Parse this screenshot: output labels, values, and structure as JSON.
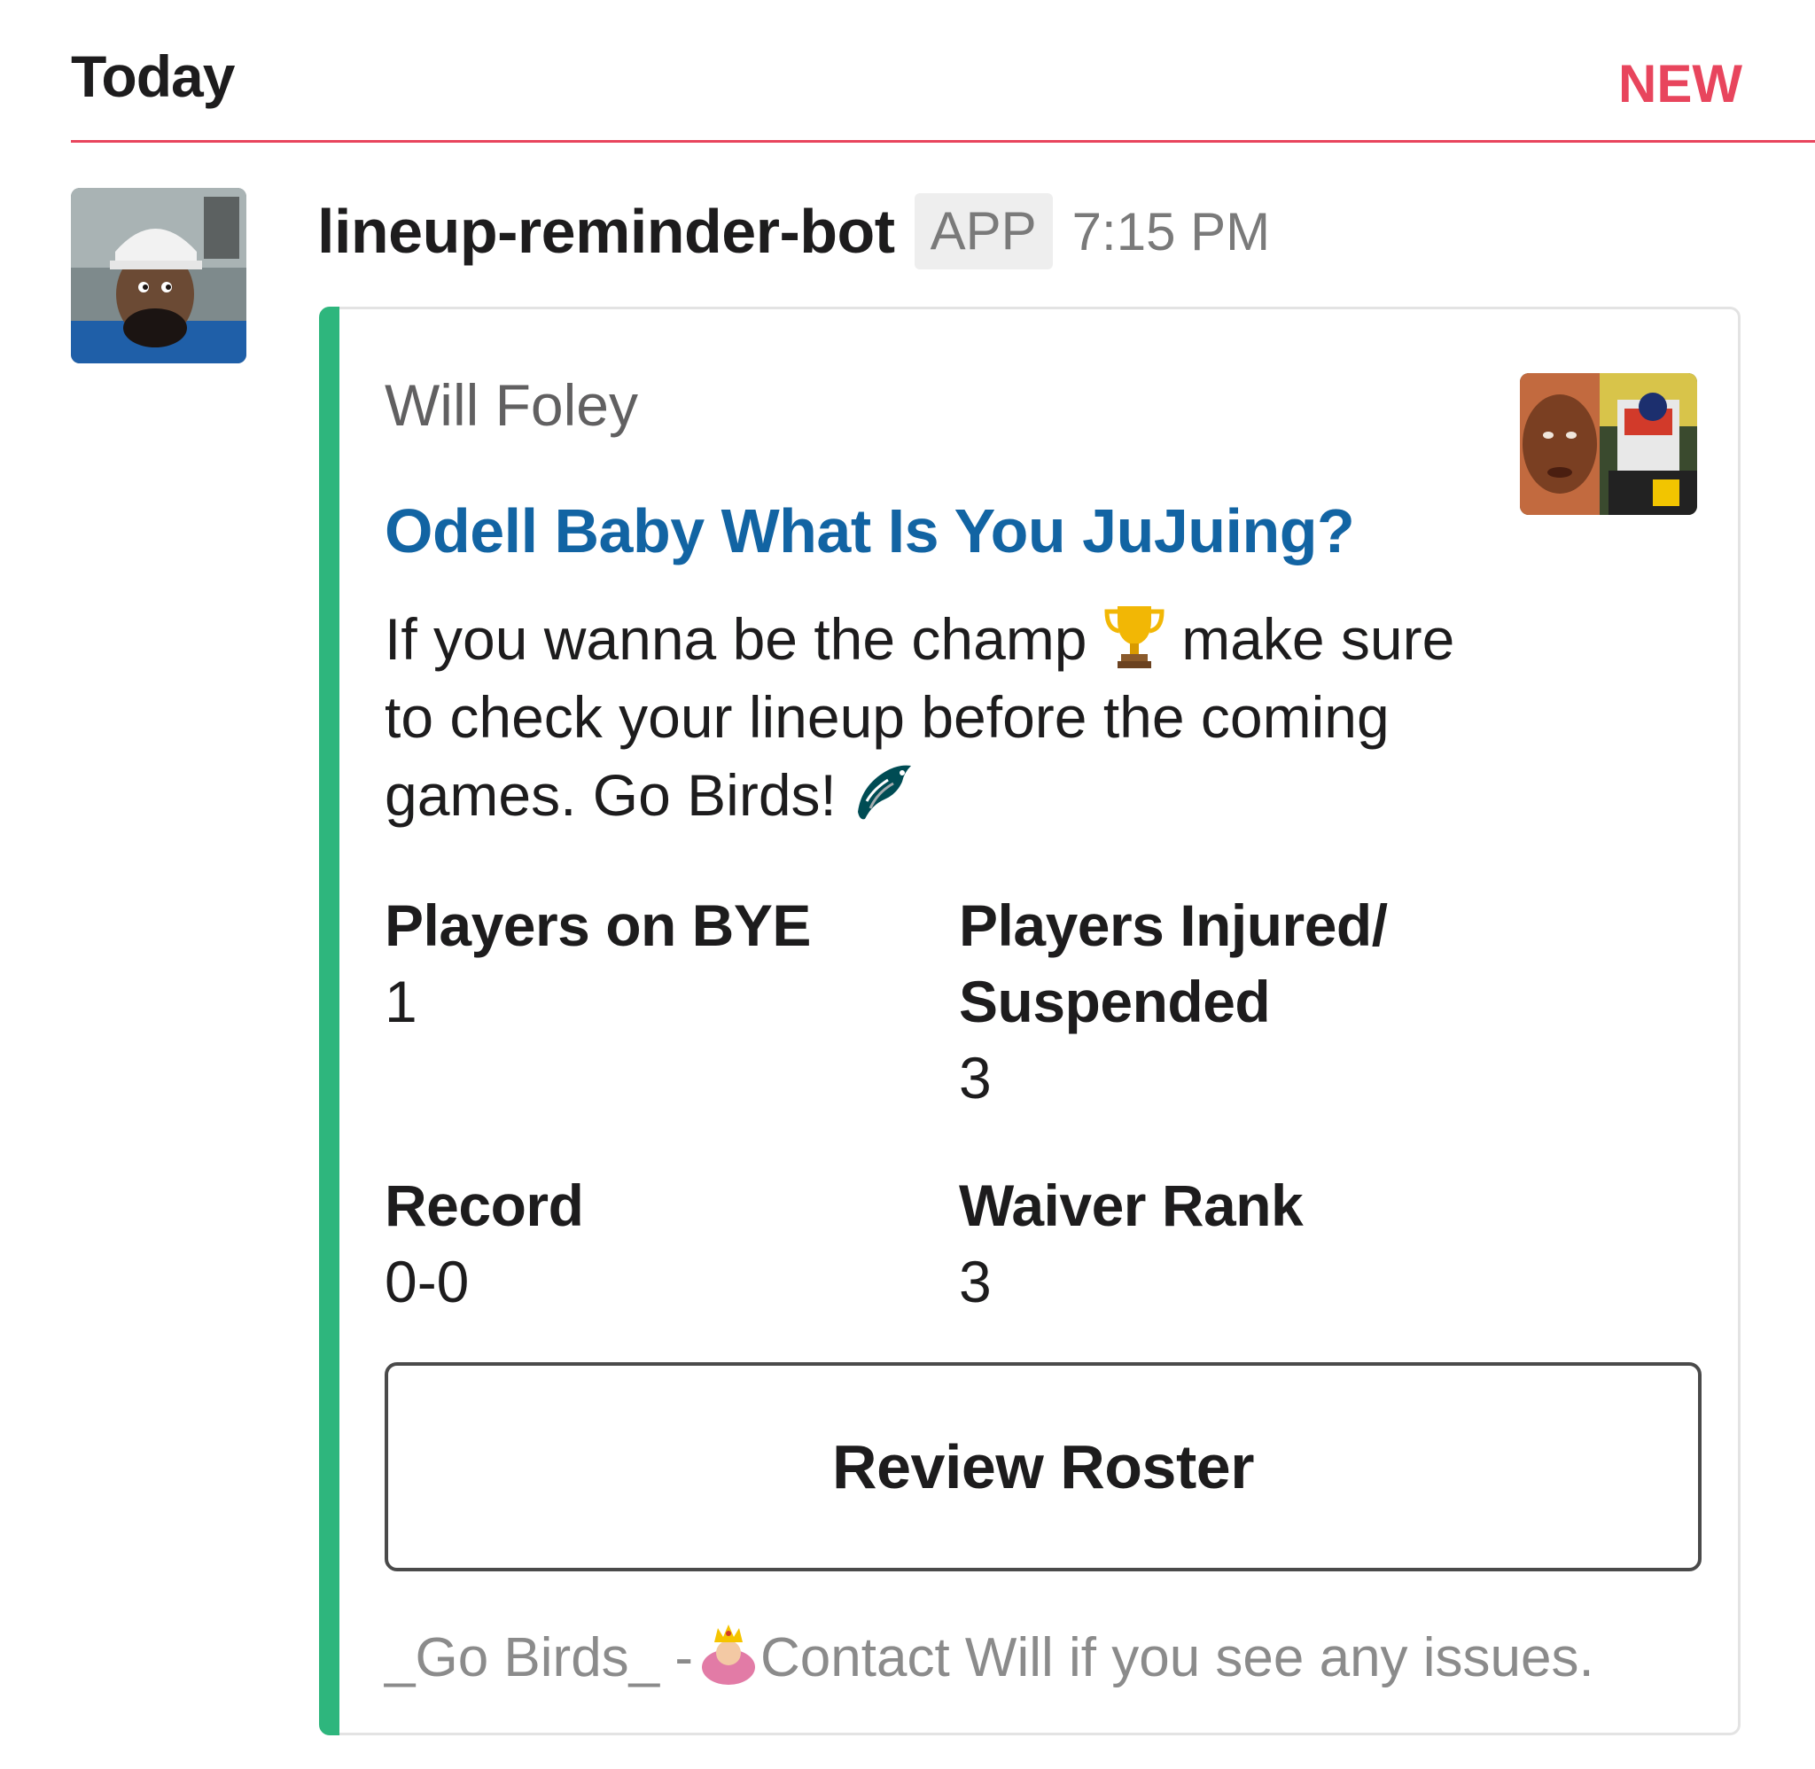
{
  "divider": {
    "day_label": "Today",
    "new_label": "NEW",
    "new_color": "#e8455d"
  },
  "message": {
    "avatar_icon": "bot-avatar",
    "sender": "lineup-reminder-bot",
    "app_badge": "APP",
    "timestamp": "7:15 PM",
    "attachment": {
      "accent_color": "#2eb67d",
      "author": "Will Foley",
      "thumbnail_icon": "author-thumbnail",
      "title": "Odell Baby What Is You JuJuing?",
      "title_color": "#1264a3",
      "text_part1": "If you wanna be the champ",
      "text_emoji1": "trophy-icon",
      "text_part2": "make sure to check your lineup before the coming games. Go Birds!",
      "text_emoji2": "eagles-logo-icon",
      "fields": {
        "bye": {
          "title": "Players on BYE",
          "value": "1"
        },
        "injured": {
          "title": "Players Injured/ Suspended",
          "value": "3"
        },
        "record": {
          "title": "Record",
          "value": "0-0"
        },
        "waiver": {
          "title": "Waiver Rank",
          "value": "3"
        }
      },
      "button_label": "Review Roster",
      "footer_part1": "_Go Birds_ -",
      "footer_emoji": "queen-crown-icon",
      "footer_part2": "Contact Will if you see any issues."
    }
  }
}
